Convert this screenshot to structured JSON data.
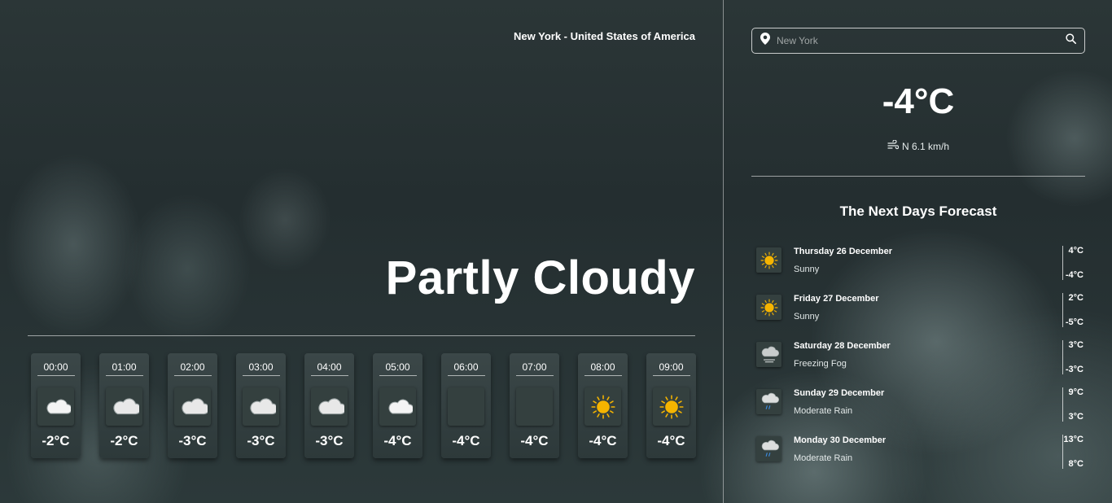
{
  "location": "New York - United States of America",
  "condition": "Partly Cloudy",
  "hourly": [
    {
      "time": "00:00",
      "icon": "night-cloud-icon",
      "temp": "-2°C"
    },
    {
      "time": "01:00",
      "icon": "cloud-icon",
      "temp": "-2°C"
    },
    {
      "time": "02:00",
      "icon": "cloud-icon",
      "temp": "-3°C"
    },
    {
      "time": "03:00",
      "icon": "cloud-icon",
      "temp": "-3°C"
    },
    {
      "time": "04:00",
      "icon": "cloud-icon",
      "temp": "-3°C"
    },
    {
      "time": "05:00",
      "icon": "night-cloud-icon",
      "temp": "-4°C"
    },
    {
      "time": "06:00",
      "icon": "moon-icon",
      "temp": "-4°C"
    },
    {
      "time": "07:00",
      "icon": "moon-icon",
      "temp": "-4°C"
    },
    {
      "time": "08:00",
      "icon": "sun-icon",
      "temp": "-4°C"
    },
    {
      "time": "09:00",
      "icon": "sun-icon",
      "temp": "-4°C"
    }
  ],
  "search": {
    "placeholder": "New York",
    "value": ""
  },
  "current": {
    "temp": "-4°C",
    "wind": "N 6.1 km/h"
  },
  "forecast_title": "The Next Days Forecast",
  "forecast": [
    {
      "day": "Thursday 26 December",
      "desc": "Sunny",
      "icon": "sun-icon",
      "high": "4°C",
      "low": "-4°C"
    },
    {
      "day": "Friday 27 December",
      "desc": "Sunny",
      "icon": "sun-icon",
      "high": "2°C",
      "low": "-5°C"
    },
    {
      "day": "Saturday 28 December",
      "desc": "Freezing Fog",
      "icon": "fog-icon",
      "high": "3°C",
      "low": "-3°C"
    },
    {
      "day": "Sunday 29 December",
      "desc": "Moderate Rain",
      "icon": "rain-cloud-icon",
      "high": "9°C",
      "low": "3°C"
    },
    {
      "day": "Monday 30 December",
      "desc": "Moderate Rain",
      "icon": "rain-cloud-icon",
      "high": "13°C",
      "low": "8°C"
    }
  ],
  "colors": {
    "sun": "#f5b400",
    "moon": "#1f7de0",
    "cloud": "#e8e8e8",
    "rain": "#3c8be0"
  }
}
